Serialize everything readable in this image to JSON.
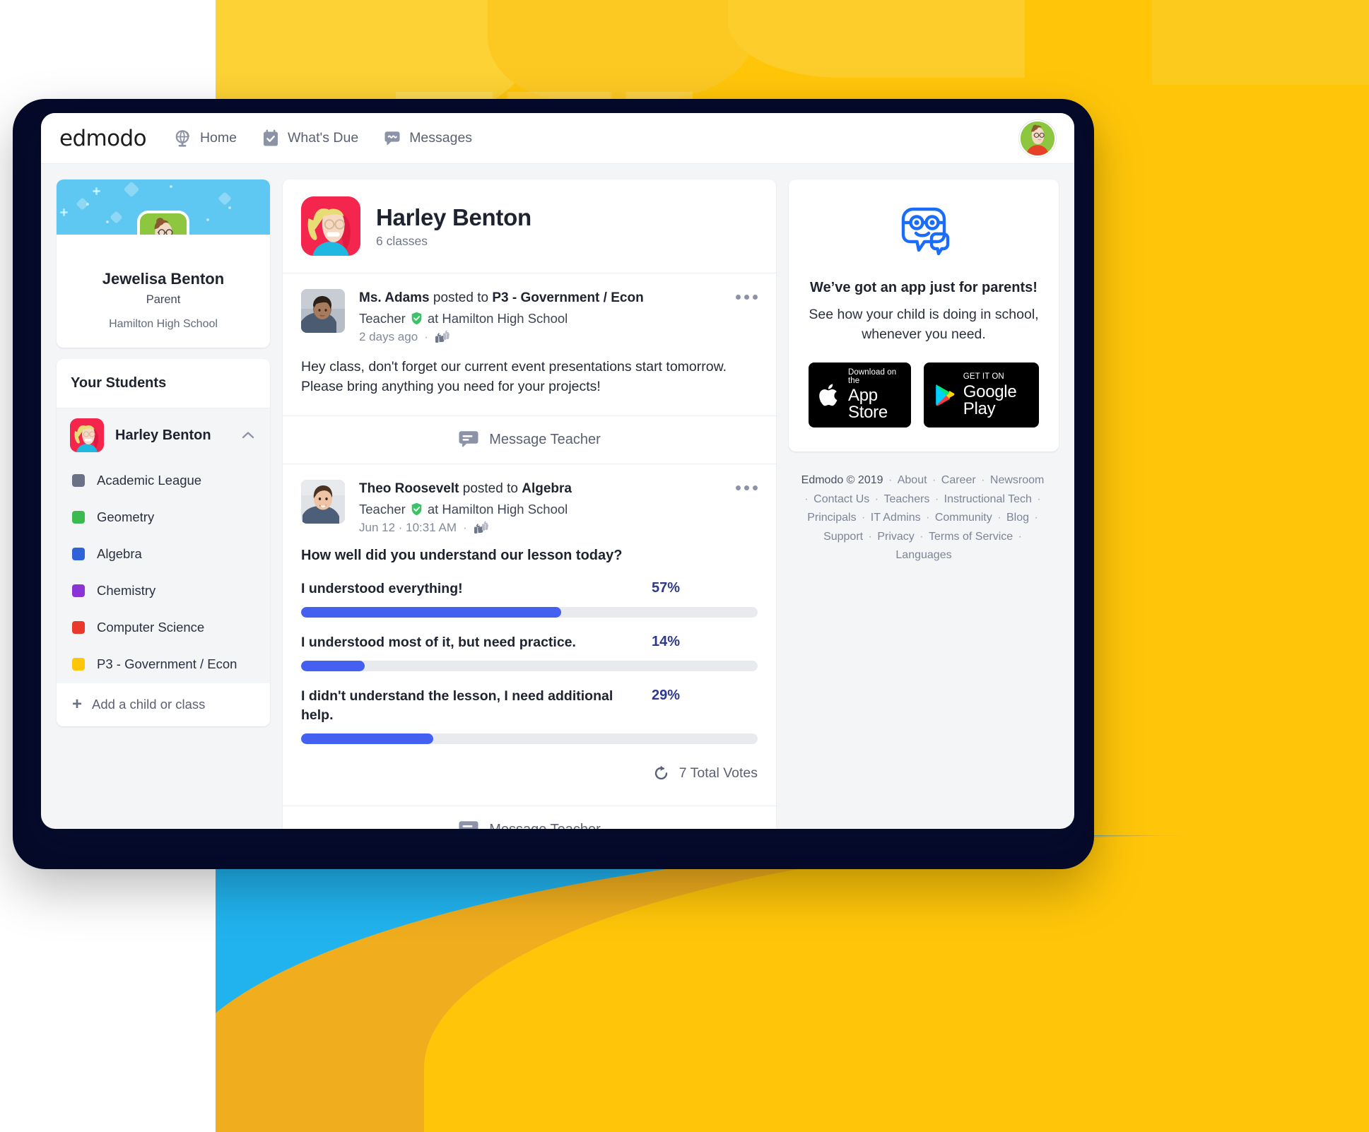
{
  "topnav": {
    "brand": "edmodo",
    "links": [
      {
        "label": "Home",
        "icon": "globe-icon"
      },
      {
        "label": "What's Due",
        "icon": "calendar-check-icon"
      },
      {
        "label": "Messages",
        "icon": "message-bubble-icon"
      }
    ],
    "avatar_name": "user-avatar"
  },
  "profile": {
    "name": "Jewelisa Benton",
    "role": "Parent",
    "school": "Hamilton High School"
  },
  "students_panel": {
    "heading": "Your Students",
    "student": {
      "name": "Harley Benton",
      "chevron": "chevron-up-icon"
    },
    "classes": [
      {
        "label": "Academic League",
        "color": "#6b7186"
      },
      {
        "label": "Geometry",
        "color": "#3cb950"
      },
      {
        "label": "Algebra",
        "color": "#2f62d6"
      },
      {
        "label": "Chemistry",
        "color": "#8b34d6"
      },
      {
        "label": "Computer Science",
        "color": "#e8392c"
      },
      {
        "label": "P3 - Government / Econ",
        "color": "#ffc609"
      }
    ],
    "add": {
      "label": "Add a child or class",
      "icon": "plus-icon"
    }
  },
  "feed_header": {
    "title": "Harley Benton",
    "subtitle": "6 classes"
  },
  "posts": [
    {
      "author": "Ms. Adams",
      "posted_to_prefix": "posted to",
      "class": "P3 - Government / Econ",
      "role": "Teacher",
      "at_school": "at Hamilton High School",
      "time": "2 days ago",
      "body": "Hey class, don't forget our current event presentations start tomorrow. Please bring anything you need for your projects!",
      "message_teacher": "Message Teacher"
    },
    {
      "author": "Theo Roosevelt",
      "posted_to_prefix": "posted to",
      "class": "Algebra",
      "role": "Teacher",
      "at_school": "at Hamilton High School",
      "time": "Jun 12 · 10:31 AM",
      "message_teacher": "Message Teacher"
    }
  ],
  "poll": {
    "question": "How well did you understand our lesson today?",
    "options": [
      {
        "label": "I understood everything!",
        "pct_label": "57%",
        "pct": 57
      },
      {
        "label": "I understood most of it, but need practice.",
        "pct_label": "14%",
        "pct": 14
      },
      {
        "label": "I didn't understand the lesson, I need additional help.",
        "pct_label": "29%",
        "pct": 29
      }
    ],
    "total_votes": "7 Total Votes",
    "bar_color": "#4460f1",
    "pct_color": "#2d3a8c"
  },
  "promo": {
    "logo": "edmodo-face-icon",
    "heading": "We’ve got an app just for parents!",
    "paragraph": "See how your child is doing in school, whenever you need.",
    "app_store": {
      "small": "Download on the",
      "big": "App Store"
    },
    "google_play": {
      "small": "GET IT ON",
      "big": "Google Play"
    }
  },
  "footer": {
    "copyright": "Edmodo © 2019",
    "links": [
      "About",
      "Career",
      "Newsroom",
      "Contact Us",
      "Teachers",
      "Instructional Tech",
      "Principals",
      "IT Admins",
      "Community",
      "Blog",
      "Support",
      "Privacy",
      "Terms of Service",
      "Languages"
    ]
  }
}
